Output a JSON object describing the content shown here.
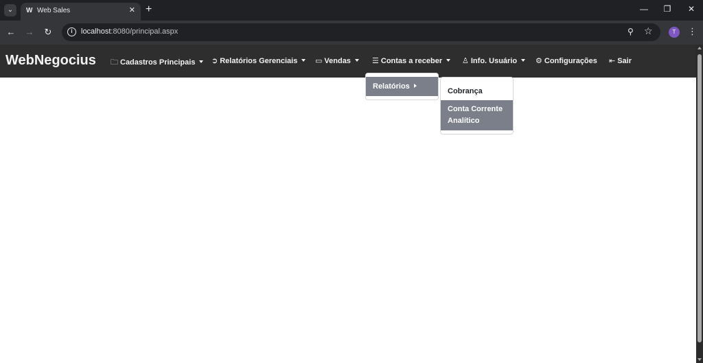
{
  "browser": {
    "tab_title": "Web Sales",
    "tab_favicon": "W̲",
    "url_host": "localhost",
    "url_path": ":8080/principal.aspx",
    "profile_initial": "T",
    "accent_profile": "#7e57c2"
  },
  "navbar": {
    "brand": "WebNegocius",
    "items": [
      {
        "label": "Cadastros Principais",
        "icon": "folder-icon",
        "has_caret": true
      },
      {
        "label": "Relatórios Gerenciais",
        "icon": "arrow-circle-icon",
        "has_caret": true
      },
      {
        "label": "Vendas",
        "icon": "briefcase-icon",
        "has_caret": true
      },
      {
        "label": "Contas a receber",
        "icon": "list-icon",
        "has_caret": true
      },
      {
        "label": "Info. Usuário",
        "icon": "user-icon",
        "has_caret": true
      },
      {
        "label": "Configurações",
        "icon": "gear-icon",
        "has_caret": false
      },
      {
        "label": "Sair",
        "icon": "logout-icon",
        "has_caret": false
      }
    ]
  },
  "dropdown": {
    "level1": {
      "label": "Relatórios"
    },
    "level2": [
      {
        "label": "Cobrança"
      },
      {
        "label": "Conta Corrente Analítico"
      }
    ],
    "active_color": "#7a7f8a"
  }
}
